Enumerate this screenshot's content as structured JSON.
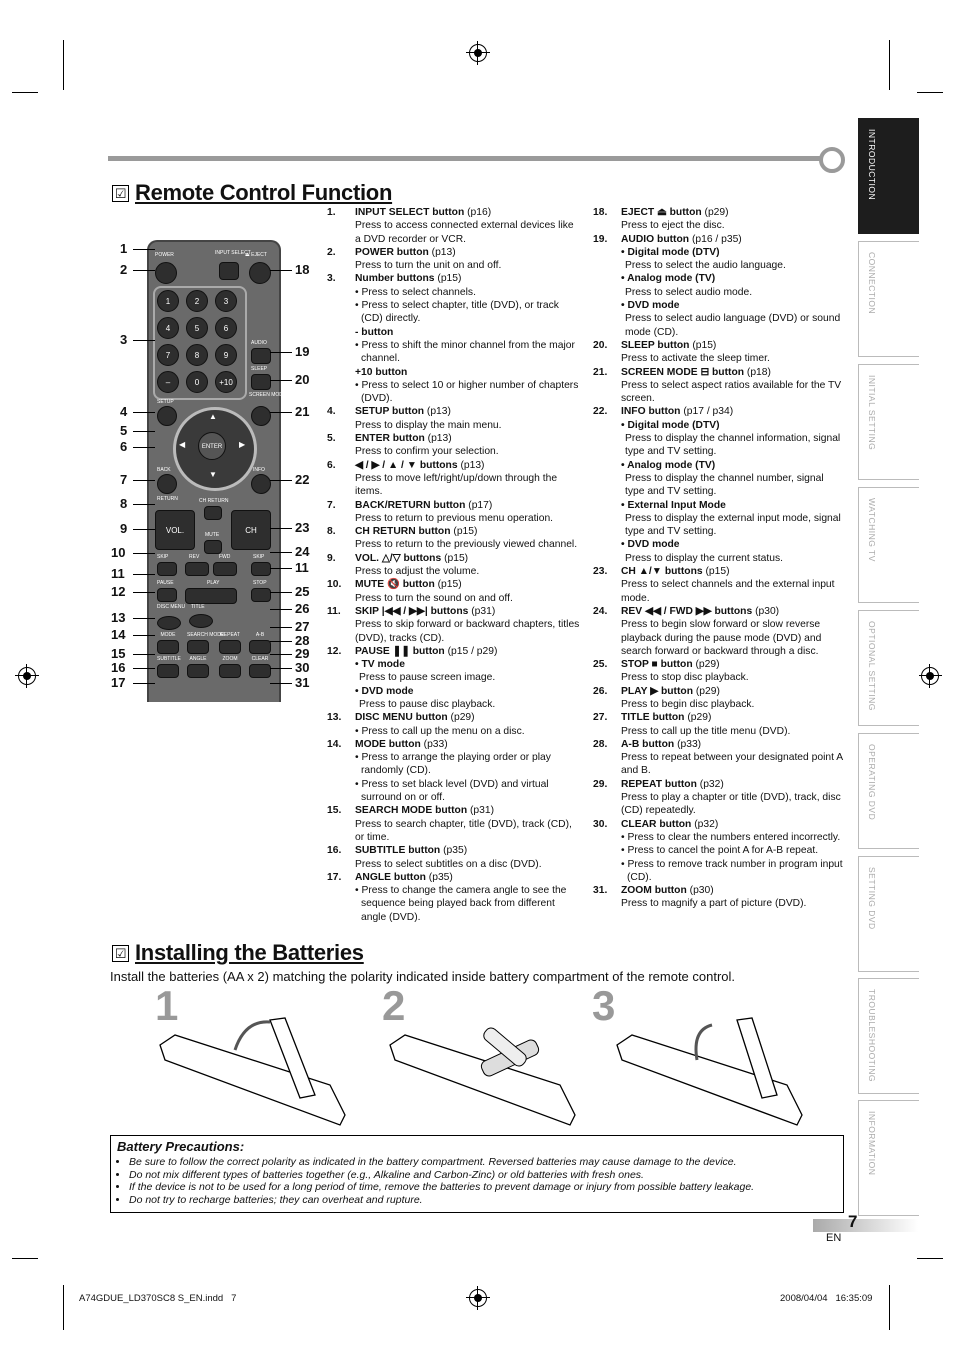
{
  "side_tabs": [
    {
      "label": "INTRODUCTION",
      "active": true
    },
    {
      "label": "CONNECTION",
      "active": false
    },
    {
      "label": "INITIAL  SETTING",
      "active": false
    },
    {
      "label": "WATCHING  TV",
      "active": false
    },
    {
      "label": "OPTIONAL  SETTING",
      "active": false
    },
    {
      "label": "OPERATING  DVD",
      "active": false
    },
    {
      "label": "SETTING  DVD",
      "active": false
    },
    {
      "label": "TROUBLESHOOTING",
      "active": false
    },
    {
      "label": "INFORMATION",
      "active": false
    }
  ],
  "remote_section": {
    "title": "Remote Control Function",
    "check_icon": "☑"
  },
  "remote": {
    "labels": {
      "power": "POWER",
      "input_select": "INPUT SELECT",
      "eject": "⏏ EJECT",
      "audio": "AUDIO",
      "sleep": "SLEEP",
      "screen_mode": "SCREEN MODE",
      "setup": "SETUP",
      "enter": "ENTER",
      "back": "BACK",
      "return": "RETURN",
      "info": "INFO",
      "ch_return": "CH RETURN",
      "vol": "VOL.",
      "ch": "CH",
      "mute": "MUTE",
      "skip": "SKIP",
      "rev": "REV",
      "fwd": "FWD",
      "pause": "PAUSE",
      "play": "PLAY",
      "stop": "STOP",
      "disc_menu": "DISC MENU",
      "title": "TITLE",
      "mode": "MODE",
      "search_mode": "SEARCH MODE",
      "repeat": "REPEAT",
      "ab": "A-B",
      "subtitle": "SUBTITLE",
      "angle": "ANGLE",
      "zoom": "ZOOM",
      "clear": "CLEAR"
    },
    "number_keys": [
      "1",
      "2",
      "3",
      "4",
      "5",
      "6",
      "7",
      "8",
      "9",
      "–",
      "0",
      "+10"
    ],
    "callouts_left": [
      "1",
      "2",
      "3",
      "4",
      "5",
      "6",
      "7",
      "8",
      "9",
      "10",
      "11",
      "12",
      "13",
      "14",
      "15",
      "16",
      "17"
    ],
    "callouts_right": [
      "18",
      "19",
      "20",
      "21",
      "22",
      "23",
      "24",
      "11",
      "25",
      "26",
      "27",
      "28",
      "29",
      "30",
      "31"
    ]
  },
  "functions_left": [
    {
      "num": "1.",
      "name": "INPUT SELECT button",
      "ref": "(p16)",
      "lines": [
        {
          "t": "text",
          "v": "Press to access connected external devices like a DVD recorder or VCR."
        }
      ]
    },
    {
      "num": "2.",
      "name": "POWER button",
      "ref": "(p13)",
      "lines": [
        {
          "t": "text",
          "v": "Press to turn the unit on and off."
        }
      ]
    },
    {
      "num": "3.",
      "name": "Number buttons",
      "ref": "(p15)",
      "lines": [
        {
          "t": "bullet",
          "v": "Press to select channels."
        },
        {
          "t": "bullet",
          "v": "Press to select chapter, title (DVD), or track (CD) directly."
        },
        {
          "t": "sub",
          "v": "- button"
        },
        {
          "t": "bullet",
          "v": "Press to shift the minor channel from the major channel."
        },
        {
          "t": "sub",
          "v": "+10 button"
        },
        {
          "t": "bullet",
          "v": "Press to select 10 or higher number of chapters (DVD)."
        }
      ]
    },
    {
      "num": "4.",
      "name": "SETUP button",
      "ref": "(p13)",
      "lines": [
        {
          "t": "text",
          "v": "Press to display the main menu."
        }
      ]
    },
    {
      "num": "5.",
      "name": "ENTER button",
      "ref": "(p13)",
      "lines": [
        {
          "t": "text",
          "v": "Press to confirm your selection."
        }
      ]
    },
    {
      "num": "6.",
      "name": "◀ / ▶ / ▲ / ▼ buttons",
      "ref": "(p13)",
      "lines": [
        {
          "t": "text",
          "v": "Press to move left/right/up/down through the items."
        }
      ]
    },
    {
      "num": "7.",
      "name": "BACK/RETURN button",
      "ref": "(p17)",
      "lines": [
        {
          "t": "text",
          "v": "Press to return to previous menu operation."
        }
      ]
    },
    {
      "num": "8.",
      "name": "CH RETURN button",
      "ref": "(p15)",
      "lines": [
        {
          "t": "text",
          "v": "Press to return to the previously viewed channel."
        }
      ]
    },
    {
      "num": "9.",
      "name": "VOL. △/▽ buttons",
      "ref": "(p15)",
      "lines": [
        {
          "t": "text",
          "v": "Press to adjust the volume."
        }
      ]
    },
    {
      "num": "10.",
      "name": "MUTE 🔇 button",
      "ref": "(p15)",
      "lines": [
        {
          "t": "text",
          "v": "Press to turn the sound on and off."
        }
      ]
    },
    {
      "num": "11.",
      "name": "SKIP |◀◀ / ▶▶| buttons",
      "ref": "(p31)",
      "lines": [
        {
          "t": "text",
          "v": "Press to skip forward or backward chapters, titles (DVD), tracks (CD)."
        }
      ]
    },
    {
      "num": "12.",
      "name": "PAUSE ❚❚ button",
      "ref": "(p15 / p29)",
      "lines": [
        {
          "t": "sub",
          "v": "• TV mode"
        },
        {
          "t": "ind",
          "v": "Press to pause screen image."
        },
        {
          "t": "sub",
          "v": "• DVD mode"
        },
        {
          "t": "ind",
          "v": "Press to pause disc playback."
        }
      ]
    },
    {
      "num": "13.",
      "name": "DISC MENU button",
      "ref": "(p29)",
      "lines": [
        {
          "t": "bullet",
          "v": "Press to call up the menu on a disc."
        }
      ]
    },
    {
      "num": "14.",
      "name": "MODE button",
      "ref": "(p33)",
      "lines": [
        {
          "t": "bullet",
          "v": "Press to arrange the playing order or play randomly (CD)."
        },
        {
          "t": "bullet",
          "v": "Press to set black level (DVD) and virtual surround on or off."
        }
      ]
    },
    {
      "num": "15.",
      "name": "SEARCH MODE button",
      "ref": "(p31)",
      "lines": [
        {
          "t": "text",
          "v": "Press to search chapter, title (DVD), track (CD), or time."
        }
      ]
    },
    {
      "num": "16.",
      "name": "SUBTITLE button",
      "ref": "(p35)",
      "lines": [
        {
          "t": "text",
          "v": "Press to select subtitles on a disc (DVD)."
        }
      ]
    },
    {
      "num": "17.",
      "name": "ANGLE button",
      "ref": "(p35)",
      "lines": [
        {
          "t": "bullet",
          "v": "Press to change the camera angle to see the sequence being played back from different angle (DVD)."
        }
      ]
    }
  ],
  "functions_right": [
    {
      "num": "18.",
      "name": "EJECT ⏏ button",
      "ref": "(p29)",
      "lines": [
        {
          "t": "text",
          "v": "Press to eject the disc."
        }
      ]
    },
    {
      "num": "19.",
      "name": "AUDIO button",
      "ref": "(p16 / p35)",
      "lines": [
        {
          "t": "sub",
          "v": "• Digital mode (DTV)"
        },
        {
          "t": "ind",
          "v": "Press to select the audio language."
        },
        {
          "t": "sub",
          "v": "• Analog mode (TV)"
        },
        {
          "t": "ind",
          "v": "Press to select audio mode."
        },
        {
          "t": "sub",
          "v": "• DVD mode"
        },
        {
          "t": "ind",
          "v": "Press to select audio language (DVD) or sound mode (CD)."
        }
      ]
    },
    {
      "num": "20.",
      "name": "SLEEP button",
      "ref": "(p15)",
      "lines": [
        {
          "t": "text",
          "v": "Press to activate the sleep timer."
        }
      ]
    },
    {
      "num": "21.",
      "name": "SCREEN MODE ⊟ button",
      "ref": "(p18)",
      "lines": [
        {
          "t": "text",
          "v": "Press to select aspect ratios available for the TV screen."
        }
      ]
    },
    {
      "num": "22.",
      "name": "INFO button",
      "ref": "(p17 / p34)",
      "lines": [
        {
          "t": "sub",
          "v": "• Digital mode (DTV)"
        },
        {
          "t": "ind",
          "v": "Press to display the channel information, signal type and TV setting."
        },
        {
          "t": "sub",
          "v": "• Analog mode (TV)"
        },
        {
          "t": "ind",
          "v": "Press to display the channel number, signal type and TV setting."
        },
        {
          "t": "sub",
          "v": "• External Input Mode"
        },
        {
          "t": "ind",
          "v": "Press to display the external input mode, signal type and TV setting."
        },
        {
          "t": "sub",
          "v": "• DVD mode"
        },
        {
          "t": "ind",
          "v": "Press to display the current status."
        }
      ]
    },
    {
      "num": "23.",
      "name": "CH ▲/▼ buttons",
      "ref": "(p15)",
      "lines": [
        {
          "t": "text",
          "v": "Press to select channels and the external input mode."
        }
      ]
    },
    {
      "num": "24.",
      "name": "REV ◀◀ / FWD ▶▶ buttons",
      "ref": "(p30)",
      "lines": [
        {
          "t": "text",
          "v": "Press to begin slow forward or slow reverse playback during the pause mode (DVD) and search forward or backward through a disc."
        }
      ]
    },
    {
      "num": "25.",
      "name": "STOP ■ button",
      "ref": "(p29)",
      "lines": [
        {
          "t": "text",
          "v": "Press to stop disc playback."
        }
      ]
    },
    {
      "num": "26.",
      "name": "PLAY ▶ button",
      "ref": "(p29)",
      "lines": [
        {
          "t": "text",
          "v": "Press to begin disc playback."
        }
      ]
    },
    {
      "num": "27.",
      "name": "TITLE button",
      "ref": "(p29)",
      "lines": [
        {
          "t": "text",
          "v": "Press to call up the title menu (DVD)."
        }
      ]
    },
    {
      "num": "28.",
      "name": "A-B button",
      "ref": "(p33)",
      "lines": [
        {
          "t": "text",
          "v": "Press to repeat between your designated point A and B."
        }
      ]
    },
    {
      "num": "29.",
      "name": "REPEAT button",
      "ref": "(p32)",
      "lines": [
        {
          "t": "text",
          "v": "Press to play a chapter or title (DVD), track, disc (CD) repeatedly."
        }
      ]
    },
    {
      "num": "30.",
      "name": "CLEAR button",
      "ref": "(p32)",
      "lines": [
        {
          "t": "bullet",
          "v": "Press to clear the numbers entered incorrectly."
        },
        {
          "t": "bullet",
          "v": "Press to cancel the point A for A-B repeat."
        },
        {
          "t": "bullet",
          "v": "Press to remove track number in program input (CD)."
        }
      ]
    },
    {
      "num": "31.",
      "name": "ZOOM button",
      "ref": "(p30)",
      "lines": [
        {
          "t": "text",
          "v": "Press to magnify a part of picture (DVD)."
        }
      ]
    }
  ],
  "battery_section": {
    "title": "Installing the Batteries",
    "check_icon": "☑",
    "intro": "Install the batteries (AA x 2) matching the polarity indicated inside battery compartment of the remote control.",
    "steps": [
      "1",
      "2",
      "3"
    ],
    "precautions_title": "Battery Precautions:",
    "precautions": [
      "Be sure to follow the correct polarity as indicated in the battery compartment. Reversed batteries may cause damage to the device.",
      "Do not mix different types of batteries together (e.g., Alkaline and Carbon-Zinc) or old batteries with fresh ones.",
      "If the device is not to be used for a long period of time, remove the batteries to prevent damage or injury from possible battery leakage.",
      "Do not try to recharge batteries; they can overheat and rupture."
    ]
  },
  "page": {
    "number": "7",
    "lang": "EN"
  },
  "slug": {
    "file": "A74GDUE_LD370SC8 S_EN.indd   7",
    "timestamp": "2008/04/04   16:35:09"
  }
}
